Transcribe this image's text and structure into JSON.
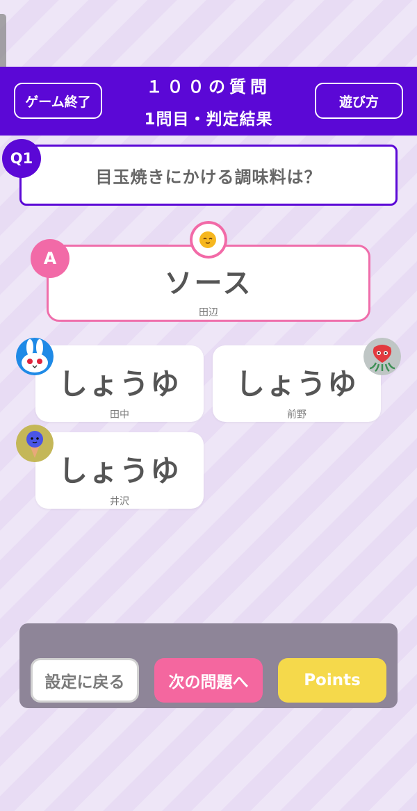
{
  "header": {
    "end_game_label": "ゲーム終了",
    "how_to_play_label": "遊び方",
    "title": "１００の質問",
    "subtitle": "1問目・判定結果"
  },
  "question": {
    "badge": "Q1",
    "text": "目玉焼きにかける調味料は？"
  },
  "answer": {
    "badge": "A",
    "text": "ソース",
    "name": "田辺",
    "avatar_icon": "fried-egg-icon"
  },
  "responses": [
    {
      "text": "しょうゆ",
      "name": "田中",
      "avatar_icon": "rabbit-icon"
    },
    {
      "text": "しょうゆ",
      "name": "前野",
      "avatar_icon": "strawberry-icon"
    },
    {
      "text": "しょうゆ",
      "name": "井沢",
      "avatar_icon": "ice-cream-icon"
    }
  ],
  "buttons": {
    "back_to_settings": "設定に戻る",
    "next_question": "次の問題へ",
    "points": "Points"
  },
  "colors": {
    "primary": "#5b08d6",
    "accent_pink": "#f26aa7",
    "points_yellow": "#f5d94b",
    "background": "#e8dcf4"
  }
}
